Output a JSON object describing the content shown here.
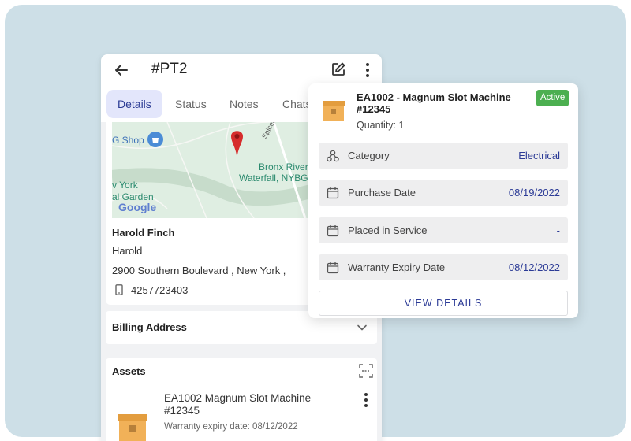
{
  "header": {
    "ticket_title": "#PT2",
    "back_icon": "arrow-left-icon",
    "edit_icon": "edit-icon",
    "more_icon": "more-vertical-icon"
  },
  "tabs": [
    {
      "label": "Details",
      "active": true
    },
    {
      "label": "Status",
      "active": false
    },
    {
      "label": "Notes",
      "active": false
    },
    {
      "label": "Chats",
      "active": false
    }
  ],
  "map": {
    "labels": {
      "shop": "G Shop",
      "garden_line1": "v York",
      "garden_line2": "al Garden",
      "road": "Spicebush T",
      "place_line1": "Bronx River",
      "place_line2": "Waterfall, NYBG",
      "brand": "Google"
    }
  },
  "contact": {
    "name": "Harold Finch",
    "first_name": "Harold",
    "address": "2900 Southern Boulevard , New York ,",
    "phone": "4257723403"
  },
  "billing": {
    "label": "Billing Address"
  },
  "assets": {
    "label": "Assets",
    "items": [
      {
        "title": "EA1002 Magnum Slot Machine #12345",
        "warranty": "Warranty expiry date: 08/12/2022"
      }
    ]
  },
  "popover": {
    "title": "EA1002 - Magnum Slot Machine #12345",
    "quantity": "Quantity: 1",
    "status": "Active",
    "rows": [
      {
        "label": "Category",
        "value": "Electrical",
        "icon": "category-icon"
      },
      {
        "label": "Purchase Date",
        "value": "08/19/2022",
        "icon": "calendar-icon"
      },
      {
        "label": "Placed in Service",
        "value": "-",
        "icon": "calendar-icon"
      },
      {
        "label": "Warranty Expiry Date",
        "value": "08/12/2022",
        "icon": "calendar-icon"
      }
    ],
    "action": "VIEW DETAILS"
  },
  "colors": {
    "background": "#cddfe7",
    "accent": "#2c3b96",
    "active_tab_bg": "#e3e6fb",
    "status_green": "#4caf50",
    "map_pin": "#d62c2c"
  }
}
